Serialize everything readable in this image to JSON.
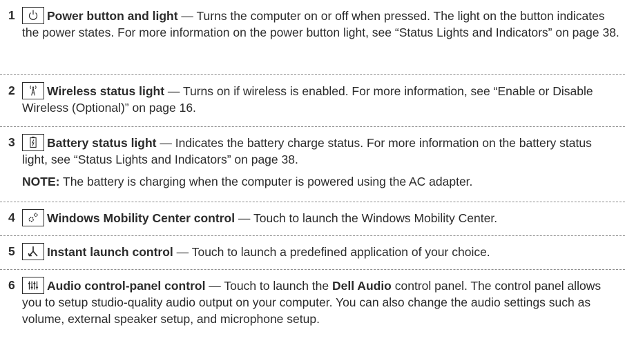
{
  "entries": [
    {
      "number": "1",
      "icon": "power-icon",
      "title": "Power button and light",
      "dash": " — ",
      "description": "Turns the computer on or off when pressed. The light on the button indicates the power states. For more information on the power button light, see “Status Lights and Indicators” on page 38."
    },
    {
      "number": "2",
      "icon": "wireless-icon",
      "title": "Wireless status light",
      "dash": " — ",
      "description": "Turns on if wireless is enabled. For more information, see “Enable or Disable Wireless (Optional)” on page 16."
    },
    {
      "number": "3",
      "icon": "battery-icon",
      "title": "Battery status light",
      "dash": " — ",
      "description": "Indicates the battery charge status. For more information on the battery status light, see “Status Lights and Indicators” on page 38.",
      "note_label": "NOTE:",
      "note_text": " The battery is charging when the computer is powered using the AC adapter."
    },
    {
      "number": "4",
      "icon": "mobility-center-icon",
      "title": "Windows Mobility Center control",
      "dash": " — ",
      "description": "Touch to launch the Windows Mobility Center."
    },
    {
      "number": "5",
      "icon": "instant-launch-icon",
      "title": "Instant launch control",
      "dash": " — ",
      "description": "Touch to launch a predefined application of your choice."
    },
    {
      "number": "6",
      "icon": "audio-control-icon",
      "title": "Audio control-panel control",
      "dash": " — ",
      "description_pre": "Touch to launch the ",
      "description_bold": "Dell Audio",
      "description_post": " control panel. The control panel allows you to setup studio-quality audio output on your computer. You can also change the audio settings such as volume, external speaker setup, and microphone setup."
    }
  ]
}
